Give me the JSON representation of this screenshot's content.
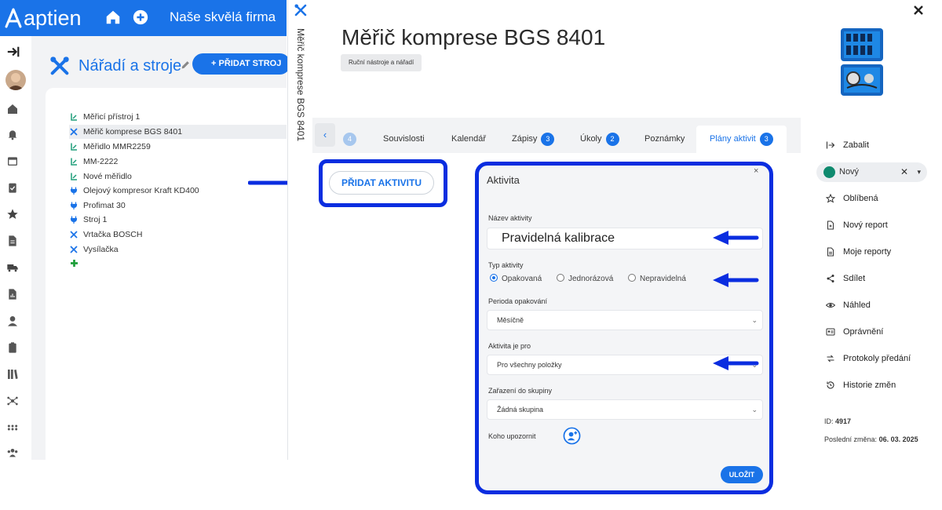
{
  "app": {
    "logo": "aptien",
    "company": "Naše skvělá firma"
  },
  "sidebar": {
    "module_title": "Nářadí a stroje",
    "add_button": "+ PŘIDAT STROJ"
  },
  "tree": {
    "items": [
      "Měřicí přístroj 1",
      "Měřič komprese BGS 8401",
      "Měřidlo MMR2259",
      "MM-2222",
      "Nové měřidlo",
      "Olejový kompresor Kraft KD400",
      "Profimat 30",
      "Stroj 1",
      "Vrtačka BOSCH",
      "Vysílačka"
    ]
  },
  "record": {
    "vertical_title": "Měřič komprese BGS 8401",
    "title": "Měřič komprese BGS 8401",
    "category_tag": "Ruční nástroje a nářadí"
  },
  "tabs": {
    "first_badge": "4",
    "items": [
      {
        "label": "Souvislosti",
        "badge": ""
      },
      {
        "label": "Kalendář",
        "badge": ""
      },
      {
        "label": "Zápisy",
        "badge": "3"
      },
      {
        "label": "Úkoly",
        "badge": "2"
      },
      {
        "label": "Poznámky",
        "badge": ""
      },
      {
        "label": "Plány aktivit",
        "badge": "3"
      }
    ]
  },
  "content": {
    "add_activity": "PŘIDAT AKTIVITU"
  },
  "modal": {
    "title": "Aktivita",
    "close": "×",
    "name_label": "Název aktivity",
    "name_value": "Pravidelná kalibrace",
    "type_label": "Typ aktivity",
    "type_options": [
      "Opakovaná",
      "Jednorázová",
      "Nepravidelná"
    ],
    "type_selected": "Opakovaná",
    "period_label": "Perioda opakování",
    "period_value": "Měsíčně",
    "for_label": "Aktivita je pro",
    "for_value": "Pro všechny položky",
    "group_label": "Zařazení do skupiny",
    "group_value": "Žádná skupina",
    "notify_label": "Koho upozornit",
    "save": "ULOŽIT"
  },
  "right_panel": {
    "collapse": "Zabalit",
    "status": "Nový",
    "status_color": "#0f8a6e",
    "actions": [
      "Oblíbená",
      "Nový report",
      "Moje reporty",
      "Sdílet",
      "Náhled",
      "Oprávnění",
      "Protokoly předání",
      "Historie změn"
    ],
    "id_label": "ID:",
    "id_value": "4917",
    "last_change_label": "Poslední změna:",
    "last_change_value": "06. 03. 2025"
  },
  "colors": {
    "accent": "#1a73e8",
    "annotation": "#0a2de0"
  }
}
